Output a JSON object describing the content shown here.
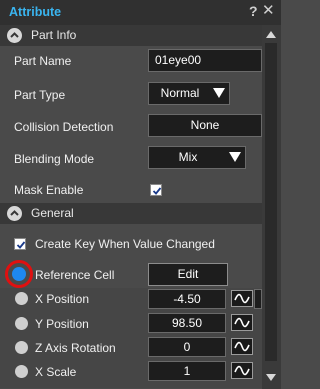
{
  "window": {
    "title": "Attribute",
    "help_glyph": "?",
    "close_glyph": "✕"
  },
  "sections": {
    "part_info": {
      "label": "Part Info"
    },
    "general": {
      "label": "General"
    }
  },
  "part_info": {
    "part_name": {
      "label": "Part Name",
      "value": "01eye00"
    },
    "part_type": {
      "label": "Part Type",
      "value": "Normal"
    },
    "collision": {
      "label": "Collision Detection",
      "value": "None"
    },
    "blending": {
      "label": "Blending Mode",
      "value": "Mix"
    },
    "mask": {
      "label": "Mask Enable",
      "checked": true
    }
  },
  "general": {
    "create_key": {
      "label": "Create Key When Value Changed",
      "checked": true
    },
    "reference_cell": {
      "label": "Reference Cell",
      "button": "Edit"
    },
    "params": [
      {
        "label": "X Position",
        "value": "-4.50"
      },
      {
        "label": "Y Position",
        "value": "98.50"
      },
      {
        "label": "Z Axis Rotation",
        "value": "0"
      },
      {
        "label": "X Scale",
        "value": "1"
      }
    ]
  },
  "colors": {
    "title": "#3ab5f0",
    "selected_radio": "#1e88f0",
    "highlight_ring": "#e01010"
  },
  "icons": [
    "help-icon",
    "close-icon",
    "chevron-up-icon",
    "checkbox-check-icon",
    "curve-icon",
    "scroll-up-icon",
    "scroll-down-icon"
  ]
}
